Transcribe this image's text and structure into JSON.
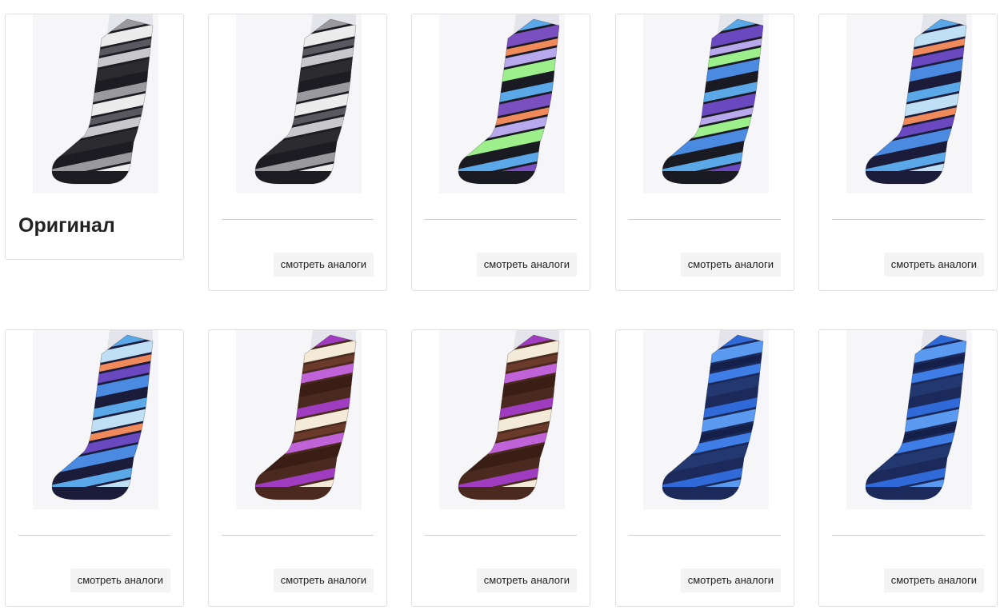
{
  "original": {
    "title": "Оригинал",
    "palette": [
      "#1c1c22",
      "#9a9a9e",
      "#ececec",
      "#58585e",
      "#c8c8cc",
      "#2b2b30"
    ]
  },
  "analog_button_label": "смотреть аналоги",
  "products": [
    {
      "palette": [
        "#1c1c22",
        "#9a9a9e",
        "#ececec",
        "#58585e",
        "#c8c8cc",
        "#2b2b30"
      ]
    },
    {
      "palette": [
        "#1a1a22",
        "#5aa8e8",
        "#7a4fc0",
        "#f08a5a",
        "#b8a8ec",
        "#9cef8a"
      ]
    },
    {
      "palette": [
        "#1a1a22",
        "#5aa8e8",
        "#6a48c0",
        "#b8a8ec",
        "#9cef8a",
        "#4a8ae0"
      ]
    },
    {
      "palette": [
        "#1b1b3a",
        "#5aa8e8",
        "#bfe0f4",
        "#f08a5a",
        "#6a48c0",
        "#4a8ae0"
      ]
    },
    {
      "palette": [
        "#1b1b3a",
        "#5aa8e8",
        "#bfe0f4",
        "#f08a5a",
        "#6a48c0",
        "#4a8ae0"
      ]
    },
    {
      "palette": [
        "#4a2a1e",
        "#a03cc0",
        "#f3ead8",
        "#6a3a2a",
        "#c062d8",
        "#3a1e16"
      ]
    },
    {
      "palette": [
        "#4a2a1e",
        "#a03cc0",
        "#f3ead8",
        "#6a3a2a",
        "#c062d8",
        "#3a1e16"
      ]
    },
    {
      "palette": [
        "#1b2a5a",
        "#2f6ad8",
        "#5a9af0",
        "#14204a",
        "#3f7ee6",
        "#22386e"
      ]
    },
    {
      "palette": [
        "#1b2a5a",
        "#2f6ad8",
        "#5a9af0",
        "#14204a",
        "#3f7ee6",
        "#22386e"
      ]
    }
  ]
}
